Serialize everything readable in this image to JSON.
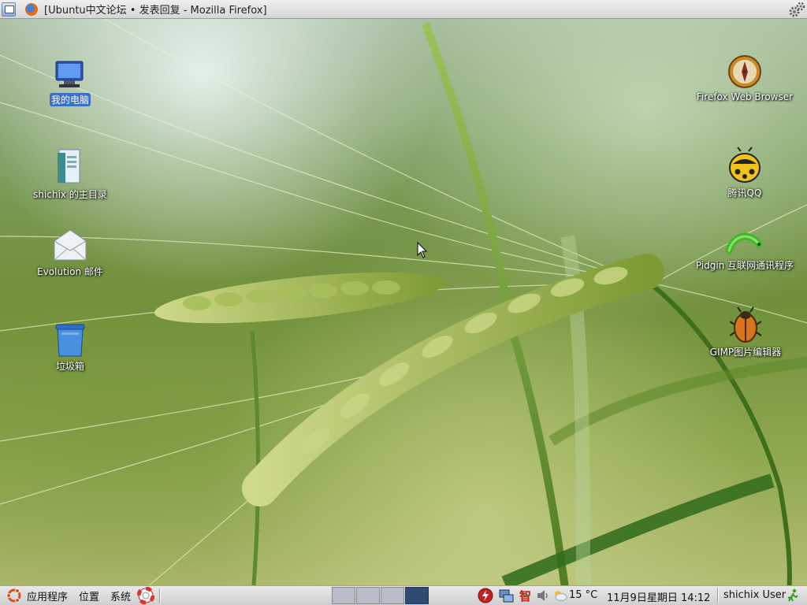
{
  "top_panel": {
    "window_title": "[Ubuntu中文论坛 • 发表回复 - Mozilla Firefox]"
  },
  "desktop_left": [
    {
      "label": "我的电脑",
      "icon": "computer-icon"
    },
    {
      "label": "shichix 的主目录",
      "icon": "home-folder-icon"
    },
    {
      "label": "Evolution 邮件",
      "icon": "mail-icon"
    },
    {
      "label": "垃圾箱",
      "icon": "trash-icon"
    }
  ],
  "desktop_right": [
    {
      "label": "Firefox Web Browser",
      "icon": "compass-icon"
    },
    {
      "label": "腾讯QQ",
      "icon": "qq-ladybug-icon"
    },
    {
      "label": "Pidgin 互联网通讯程序",
      "icon": "pidgin-icon"
    },
    {
      "label": "GIMP图片编辑器",
      "icon": "gimp-bug-icon"
    }
  ],
  "bottom_panel": {
    "menus": [
      "应用程序",
      "位置",
      "系统"
    ],
    "temperature": "15 °C",
    "clock": "11月9日星期日 14:12",
    "user": "shichix User"
  },
  "colors": {
    "selection": "#3c6fc6",
    "active_workspace": "#2f4b73",
    "panel": "#dcdcdc"
  }
}
